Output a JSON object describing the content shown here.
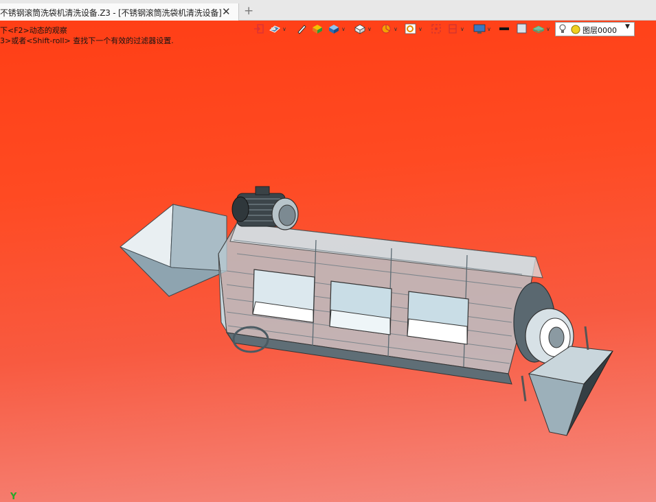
{
  "tab": {
    "title": "不锈钢滚筒洗袋机清洗设备.Z3 - [不锈钢滚筒洗袋机清洗设备]"
  },
  "hints": {
    "line1": "下<F2>动态的观察",
    "line2": "3>或者<Shift-roll> 查找下一个有效的过滤器设置."
  },
  "layer": {
    "name": "图层0000"
  },
  "axis": {
    "y_label": "Y"
  },
  "toolbar_icons": [
    "exit-icon",
    "render-icon",
    "pen-icon",
    "cube-color-icon",
    "cube-blue-icon",
    "cube-white-icon",
    "pie-icon",
    "zoom-icon",
    "fit-icon",
    "section-icon",
    "display-icon",
    "line-style-icon",
    "fill-icon",
    "layer-stack-icon"
  ],
  "colors": {
    "background_top": "#ff3d14",
    "background_bottom": "#f48a80",
    "layer_bulb": "#f0d020"
  }
}
